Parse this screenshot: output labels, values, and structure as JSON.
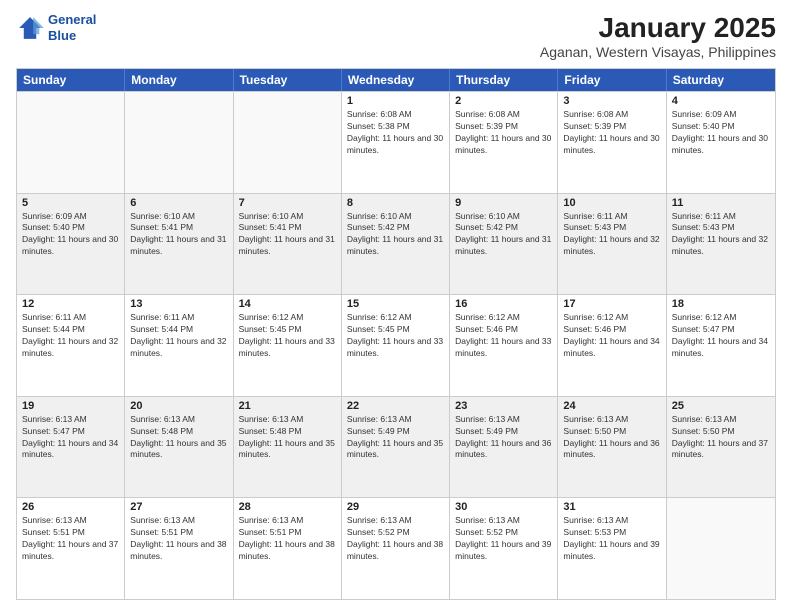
{
  "logo": {
    "line1": "General",
    "line2": "Blue"
  },
  "title": "January 2025",
  "subtitle": "Aganan, Western Visayas, Philippines",
  "headers": [
    "Sunday",
    "Monday",
    "Tuesday",
    "Wednesday",
    "Thursday",
    "Friday",
    "Saturday"
  ],
  "weeks": [
    [
      {
        "day": "",
        "sunrise": "",
        "sunset": "",
        "daylight": "",
        "empty": true
      },
      {
        "day": "",
        "sunrise": "",
        "sunset": "",
        "daylight": "",
        "empty": true
      },
      {
        "day": "",
        "sunrise": "",
        "sunset": "",
        "daylight": "",
        "empty": true
      },
      {
        "day": "1",
        "sunrise": "Sunrise: 6:08 AM",
        "sunset": "Sunset: 5:38 PM",
        "daylight": "Daylight: 11 hours and 30 minutes."
      },
      {
        "day": "2",
        "sunrise": "Sunrise: 6:08 AM",
        "sunset": "Sunset: 5:39 PM",
        "daylight": "Daylight: 11 hours and 30 minutes."
      },
      {
        "day": "3",
        "sunrise": "Sunrise: 6:08 AM",
        "sunset": "Sunset: 5:39 PM",
        "daylight": "Daylight: 11 hours and 30 minutes."
      },
      {
        "day": "4",
        "sunrise": "Sunrise: 6:09 AM",
        "sunset": "Sunset: 5:40 PM",
        "daylight": "Daylight: 11 hours and 30 minutes."
      }
    ],
    [
      {
        "day": "5",
        "sunrise": "Sunrise: 6:09 AM",
        "sunset": "Sunset: 5:40 PM",
        "daylight": "Daylight: 11 hours and 30 minutes.",
        "shaded": true
      },
      {
        "day": "6",
        "sunrise": "Sunrise: 6:10 AM",
        "sunset": "Sunset: 5:41 PM",
        "daylight": "Daylight: 11 hours and 31 minutes.",
        "shaded": true
      },
      {
        "day": "7",
        "sunrise": "Sunrise: 6:10 AM",
        "sunset": "Sunset: 5:41 PM",
        "daylight": "Daylight: 11 hours and 31 minutes.",
        "shaded": true
      },
      {
        "day": "8",
        "sunrise": "Sunrise: 6:10 AM",
        "sunset": "Sunset: 5:42 PM",
        "daylight": "Daylight: 11 hours and 31 minutes.",
        "shaded": true
      },
      {
        "day": "9",
        "sunrise": "Sunrise: 6:10 AM",
        "sunset": "Sunset: 5:42 PM",
        "daylight": "Daylight: 11 hours and 31 minutes.",
        "shaded": true
      },
      {
        "day": "10",
        "sunrise": "Sunrise: 6:11 AM",
        "sunset": "Sunset: 5:43 PM",
        "daylight": "Daylight: 11 hours and 32 minutes.",
        "shaded": true
      },
      {
        "day": "11",
        "sunrise": "Sunrise: 6:11 AM",
        "sunset": "Sunset: 5:43 PM",
        "daylight": "Daylight: 11 hours and 32 minutes.",
        "shaded": true
      }
    ],
    [
      {
        "day": "12",
        "sunrise": "Sunrise: 6:11 AM",
        "sunset": "Sunset: 5:44 PM",
        "daylight": "Daylight: 11 hours and 32 minutes."
      },
      {
        "day": "13",
        "sunrise": "Sunrise: 6:11 AM",
        "sunset": "Sunset: 5:44 PM",
        "daylight": "Daylight: 11 hours and 32 minutes."
      },
      {
        "day": "14",
        "sunrise": "Sunrise: 6:12 AM",
        "sunset": "Sunset: 5:45 PM",
        "daylight": "Daylight: 11 hours and 33 minutes."
      },
      {
        "day": "15",
        "sunrise": "Sunrise: 6:12 AM",
        "sunset": "Sunset: 5:45 PM",
        "daylight": "Daylight: 11 hours and 33 minutes."
      },
      {
        "day": "16",
        "sunrise": "Sunrise: 6:12 AM",
        "sunset": "Sunset: 5:46 PM",
        "daylight": "Daylight: 11 hours and 33 minutes."
      },
      {
        "day": "17",
        "sunrise": "Sunrise: 6:12 AM",
        "sunset": "Sunset: 5:46 PM",
        "daylight": "Daylight: 11 hours and 34 minutes."
      },
      {
        "day": "18",
        "sunrise": "Sunrise: 6:12 AM",
        "sunset": "Sunset: 5:47 PM",
        "daylight": "Daylight: 11 hours and 34 minutes."
      }
    ],
    [
      {
        "day": "19",
        "sunrise": "Sunrise: 6:13 AM",
        "sunset": "Sunset: 5:47 PM",
        "daylight": "Daylight: 11 hours and 34 minutes.",
        "shaded": true
      },
      {
        "day": "20",
        "sunrise": "Sunrise: 6:13 AM",
        "sunset": "Sunset: 5:48 PM",
        "daylight": "Daylight: 11 hours and 35 minutes.",
        "shaded": true
      },
      {
        "day": "21",
        "sunrise": "Sunrise: 6:13 AM",
        "sunset": "Sunset: 5:48 PM",
        "daylight": "Daylight: 11 hours and 35 minutes.",
        "shaded": true
      },
      {
        "day": "22",
        "sunrise": "Sunrise: 6:13 AM",
        "sunset": "Sunset: 5:49 PM",
        "daylight": "Daylight: 11 hours and 35 minutes.",
        "shaded": true
      },
      {
        "day": "23",
        "sunrise": "Sunrise: 6:13 AM",
        "sunset": "Sunset: 5:49 PM",
        "daylight": "Daylight: 11 hours and 36 minutes.",
        "shaded": true
      },
      {
        "day": "24",
        "sunrise": "Sunrise: 6:13 AM",
        "sunset": "Sunset: 5:50 PM",
        "daylight": "Daylight: 11 hours and 36 minutes.",
        "shaded": true
      },
      {
        "day": "25",
        "sunrise": "Sunrise: 6:13 AM",
        "sunset": "Sunset: 5:50 PM",
        "daylight": "Daylight: 11 hours and 37 minutes.",
        "shaded": true
      }
    ],
    [
      {
        "day": "26",
        "sunrise": "Sunrise: 6:13 AM",
        "sunset": "Sunset: 5:51 PM",
        "daylight": "Daylight: 11 hours and 37 minutes."
      },
      {
        "day": "27",
        "sunrise": "Sunrise: 6:13 AM",
        "sunset": "Sunset: 5:51 PM",
        "daylight": "Daylight: 11 hours and 38 minutes."
      },
      {
        "day": "28",
        "sunrise": "Sunrise: 6:13 AM",
        "sunset": "Sunset: 5:51 PM",
        "daylight": "Daylight: 11 hours and 38 minutes."
      },
      {
        "day": "29",
        "sunrise": "Sunrise: 6:13 AM",
        "sunset": "Sunset: 5:52 PM",
        "daylight": "Daylight: 11 hours and 38 minutes."
      },
      {
        "day": "30",
        "sunrise": "Sunrise: 6:13 AM",
        "sunset": "Sunset: 5:52 PM",
        "daylight": "Daylight: 11 hours and 39 minutes."
      },
      {
        "day": "31",
        "sunrise": "Sunrise: 6:13 AM",
        "sunset": "Sunset: 5:53 PM",
        "daylight": "Daylight: 11 hours and 39 minutes."
      },
      {
        "day": "",
        "sunrise": "",
        "sunset": "",
        "daylight": "",
        "empty": true
      }
    ]
  ]
}
